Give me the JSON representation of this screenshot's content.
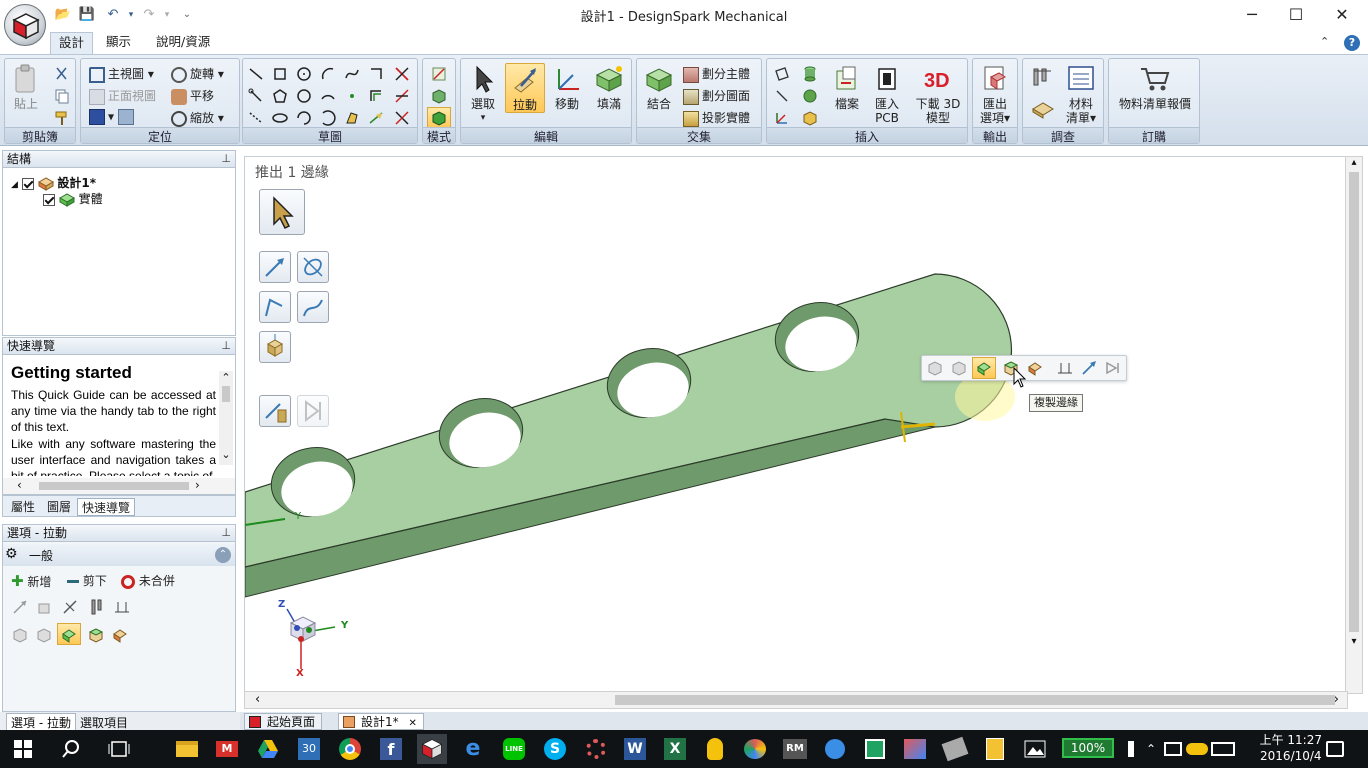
{
  "window": {
    "title": "設計1 - DesignSpark Mechanical",
    "minimize": "─",
    "maximize": "☐",
    "close": "✕"
  },
  "ribbon_tabs": [
    {
      "label": "設計",
      "active": true
    },
    {
      "label": "顯示",
      "active": false
    },
    {
      "label": "說明/資源",
      "active": false
    }
  ],
  "ribbon": {
    "clipboard": {
      "label": "剪貼簿",
      "paste": "貼上"
    },
    "orient": {
      "label": "定位",
      "home": "主視圖",
      "front": "正面視圖",
      "rotate": "旋轉",
      "pan": "平移",
      "zoom": "縮放"
    },
    "sketch": {
      "label": "草圖"
    },
    "mode": {
      "label": "模式"
    },
    "edit": {
      "label": "編輯",
      "select": "選取",
      "pull": "拉動",
      "move": "移動",
      "fill": "填滿"
    },
    "intersect": {
      "label": "交集",
      "combine": "結合",
      "split_body": "劃分主體",
      "split_face": "劃分圖面",
      "project": "投影實體"
    },
    "insert": {
      "label": "插入",
      "file": "檔案",
      "import_pcb_1": "匯入",
      "import_pcb_2": "PCB",
      "download_3d_1": "下載 3D",
      "download_3d_2": "模型"
    },
    "output": {
      "label": "輸出",
      "export_1": "匯出",
      "export_2": "選項"
    },
    "investigate": {
      "label": "調查",
      "bom_1": "材料",
      "bom_2": "清單"
    },
    "order": {
      "label": "訂購",
      "quote": "物料清單報價"
    }
  },
  "structure": {
    "title": "結構",
    "root": "設計1*",
    "child": "實體"
  },
  "quick_guide": {
    "title": "快速導覽",
    "heading": "Getting started",
    "p1": "This Quick Guide can be accessed at any time via the handy tab to the right of this text.",
    "p2": "Like with any software mastering the user interface and navigation takes a bit of practice. Please select a topic of"
  },
  "panel_tabs": [
    {
      "label": "屬性",
      "active": false
    },
    {
      "label": "圖層",
      "active": false
    },
    {
      "label": "快速導覽",
      "active": true
    }
  ],
  "options": {
    "title": "選項 - 拉動",
    "section": "一般",
    "add": "新增",
    "cut": "剪下",
    "no_merge": "未合併"
  },
  "viewport": {
    "status": "推出 1 邊緣",
    "tooltip": "複製邊緣",
    "axis_x": "X",
    "axis_y": "Y",
    "axis_z": "Z",
    "edge_y": "Y"
  },
  "bottom_tabs": {
    "left1": "選項 - 拉動",
    "left2": "選取項目",
    "doc1": "起始頁面",
    "doc2": "設計1*"
  },
  "taskbar": {
    "battery": "100%",
    "time": "上午 11:27",
    "date": "2016/10/4",
    "calendar_day": "30"
  },
  "colors": {
    "part_fill": "#a8cfa2",
    "part_side": "#6f9a6b",
    "accent": "#ffc857",
    "taskbar": "#101316"
  }
}
